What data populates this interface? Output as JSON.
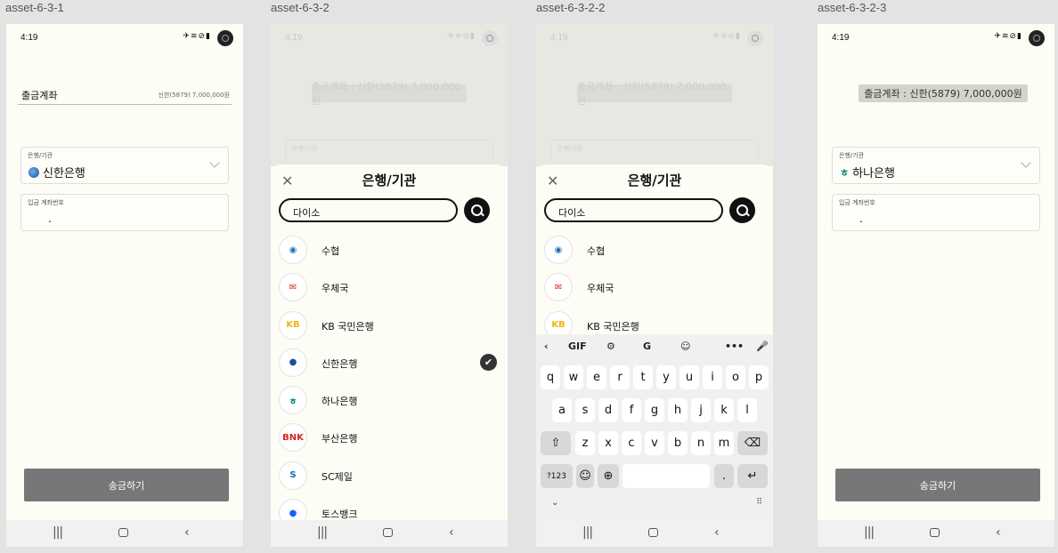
{
  "frames": {
    "s1": "asset-6-3-1",
    "s2": "asset-6-3-2",
    "s3": "asset-6-3-2-2",
    "s4": "asset-6-3-2-3"
  },
  "status": {
    "time": "4:19",
    "icons": "✈≋⊘▮"
  },
  "nav": {
    "recent": "|||",
    "back": "‹"
  },
  "form": {
    "from_label": "출금계좌",
    "from_value": "신한(5879)  7,000,000원",
    "from_chip": "출금계좌 : 신한(5879) 7,000,000원",
    "bank_caption": "은행/기관",
    "bank_selected_1": "신한은행",
    "bank_selected_4": "하나은행",
    "account_caption": "입금 계좌번호",
    "account_value": ".",
    "send_label": "송금하기"
  },
  "sheet": {
    "close": "✕",
    "title": "은행/기관",
    "search_value": "다이소"
  },
  "banks": [
    {
      "name": "수협",
      "icon": "suhyup-icon",
      "glyph": "◉",
      "color": "#1f6fb9"
    },
    {
      "name": "우체국",
      "icon": "post-office-icon",
      "glyph": "✉",
      "color": "#d8261f"
    },
    {
      "name": "KB 국민은행",
      "icon": "kb-icon",
      "glyph": "KB",
      "color": "#f3b50c"
    },
    {
      "name": "신한은행",
      "icon": "shinhan-icon",
      "glyph": "●",
      "color": "#1c4e9b",
      "selected": true
    },
    {
      "name": "하나은행",
      "icon": "hana-icon",
      "glyph": "ㅎ",
      "color": "#008c73"
    },
    {
      "name": "부산은행",
      "icon": "bnk-icon",
      "glyph": "BNK",
      "color": "#d8261f"
    },
    {
      "name": "SC제일",
      "icon": "sc-icon",
      "glyph": "S",
      "color": "#0a6bb5"
    },
    {
      "name": "토스뱅크",
      "icon": "toss-icon",
      "glyph": "●",
      "color": "#1a5cff"
    }
  ],
  "keyboard": {
    "tools": [
      "‹",
      "GIF",
      "⚙",
      "G",
      "☺",
      "•••",
      "🎤"
    ],
    "row1": [
      "q",
      "w",
      "e",
      "r",
      "t",
      "y",
      "u",
      "i",
      "o",
      "p"
    ],
    "row2": [
      "a",
      "s",
      "d",
      "f",
      "g",
      "h",
      "j",
      "k",
      "l"
    ],
    "row3": [
      "z",
      "x",
      "c",
      "v",
      "b",
      "n",
      "m"
    ],
    "shift": "⇧",
    "backspace": "⌫",
    "num": "?123",
    "emoji": "☺",
    "globe": "⊕",
    "period": ".",
    "enter": "↵",
    "hide": "⌄",
    "grid": "⠿"
  }
}
